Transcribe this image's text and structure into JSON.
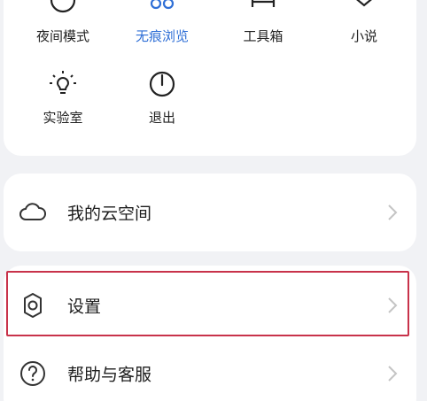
{
  "quick_actions": [
    {
      "label": "夜间模式",
      "icon": "moon-icon"
    },
    {
      "label": "无痕浏览",
      "icon": "incognito-icon"
    },
    {
      "label": "工具箱",
      "icon": "toolbox-icon"
    },
    {
      "label": "小说",
      "icon": "book-icon"
    },
    {
      "label": "实验室",
      "icon": "lightbulb-icon"
    },
    {
      "label": "退出",
      "icon": "power-icon"
    }
  ],
  "menu": {
    "cloud": {
      "label": "我的云空间",
      "icon": "cloud-icon"
    },
    "settings": {
      "label": "设置",
      "icon": "gear-icon"
    },
    "help": {
      "label": "帮助与客服",
      "icon": "help-icon"
    }
  },
  "colors": {
    "active": "#2f6fd6",
    "highlight": "#c8324a",
    "background": "#f1f2f5"
  }
}
